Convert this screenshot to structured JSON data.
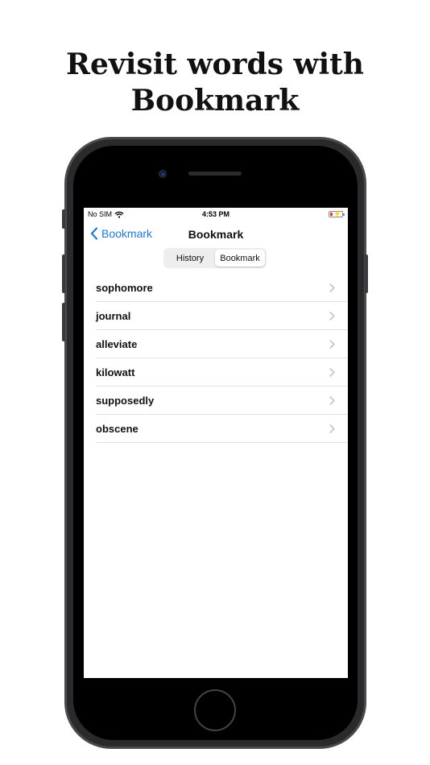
{
  "headline": {
    "line1": "Revisit words with",
    "line2": "Bookmark"
  },
  "status_bar": {
    "carrier": "No SIM",
    "time": "4:53 PM"
  },
  "nav": {
    "back_label": "Bookmark",
    "title": "Bookmark"
  },
  "segments": [
    "History",
    "Bookmark"
  ],
  "selected_segment": "Bookmark",
  "words": [
    "sophomore",
    "journal",
    "alleviate",
    "kilowatt",
    "supposedly",
    "obscene"
  ],
  "colors": {
    "accent": "#1a7bdc",
    "battery_low": "#e53935"
  },
  "icons": {
    "back": "chevron-left-icon",
    "row": "chevron-right-icon",
    "wifi": "wifi-icon",
    "battery": "battery-icon"
  }
}
